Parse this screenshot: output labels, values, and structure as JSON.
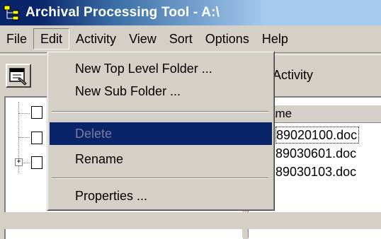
{
  "window": {
    "title": "Archival Processing Tool - A:\\"
  },
  "menubar": {
    "items": [
      "File",
      "Edit",
      "Activity",
      "View",
      "Sort",
      "Options",
      "Help"
    ],
    "active": "Edit"
  },
  "toolbar": {
    "properties_icon": "properties-icon",
    "activity_label": ": Activity"
  },
  "edit_menu": {
    "items": [
      {
        "label": "New Top Level Folder ...",
        "enabled": true
      },
      {
        "label": "New Sub Folder ...",
        "enabled": true
      },
      {
        "label": "Delete",
        "enabled": false,
        "highlighted": true
      },
      {
        "label": "Rename",
        "enabled": true
      },
      {
        "label": "Properties ...",
        "enabled": true
      }
    ]
  },
  "list": {
    "header_name": "ame",
    "files": [
      "89020100.doc",
      "89030601.doc",
      "89030103.doc"
    ],
    "selected_index": 0
  },
  "colors": {
    "highlight": "#0a246a",
    "face": "#d4d0c8",
    "disabled_text": "#808080"
  }
}
